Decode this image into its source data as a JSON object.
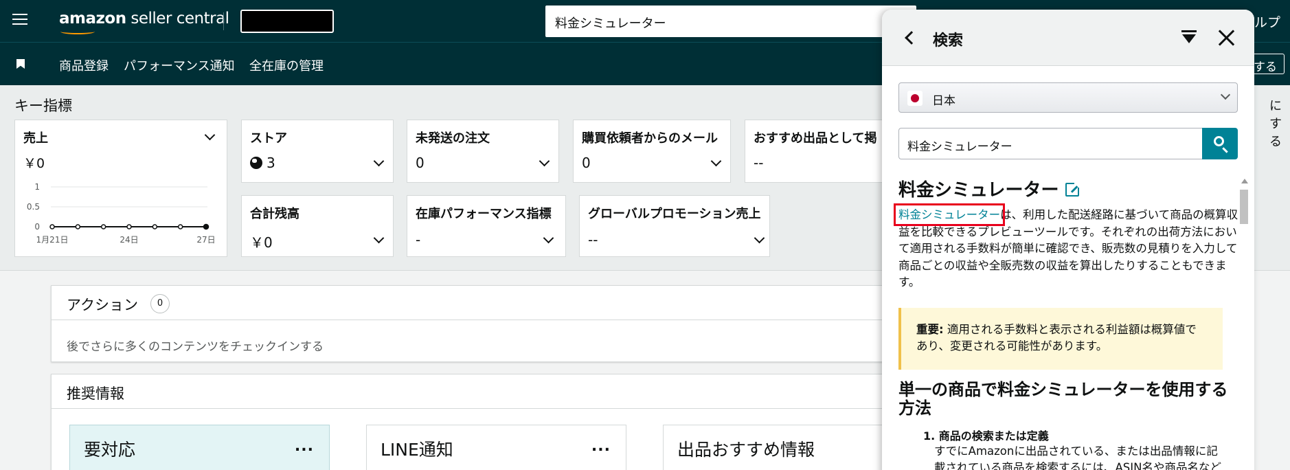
{
  "header": {
    "logo_main": "amazon",
    "logo_sub": " seller central",
    "search_value": "料金シミュレーター",
    "help_partial": "ルプ"
  },
  "nav": {
    "items": [
      "商品登録",
      "パフォーマンス通知",
      "全在庫の管理"
    ],
    "right_button_partial": "する"
  },
  "key_metrics": {
    "title": "キー指標",
    "right_partial": "にする",
    "sales": {
      "title": "売上",
      "value": "￥0",
      "y_ticks": [
        "1",
        "0.5",
        "0"
      ],
      "x_ticks": [
        "1月21日",
        "24日",
        "27日"
      ]
    },
    "cards": [
      {
        "title": "ストア",
        "value": "3"
      },
      {
        "title": "未発送の注文",
        "value": "0"
      },
      {
        "title": "購買依頼者からのメール",
        "value": "0"
      },
      {
        "title": "おすすめ出品として掲",
        "value": "--"
      },
      {
        "title": "合計残高",
        "value": "￥0"
      },
      {
        "title": "在庫パフォーマンス指標",
        "value": "-"
      },
      {
        "title": "グローバルプロモーション売上",
        "value": "--"
      }
    ]
  },
  "actions": {
    "title": "アクション",
    "count": "0",
    "empty_text": "後でさらに多くのコンテンツをチェックインする"
  },
  "recommendations": {
    "title": "推奨情報",
    "cards": [
      {
        "title": "要対応",
        "menu": "..."
      },
      {
        "title": "LINE通知",
        "menu": "..."
      },
      {
        "title": "出品おすすめ情報"
      }
    ]
  },
  "help_panel": {
    "title": "検索",
    "country": "日本",
    "search_value": "料金シミュレーター",
    "article_title": "料金シミュレーター",
    "link_text": "料金シミュレーター",
    "body_rest": "は、利用した配送経路に基づいて商品の概算収益を比較できるプレビューツールです。それぞれの出荷方法において適用される手数料が簡単に確認でき、販売数の見積りを入力して商品ごとの収益や全販売数の収益を算出したりすることもできます。",
    "note_label": "重要:",
    "note_text": " 適用される手数料と表示される利益額は概算値であり、変更される可能性があります。",
    "section_heading": "単一の商品で料金シミュレーターを使用する方法",
    "step_1_title": "1. 商品の検索または定義",
    "step_1_text": "すでにAmazonに出品されている、または出品情報に記載されている商品を検索するには、ASIN名や商品名などを入力して検索します。"
  },
  "chart_data": {
    "type": "line",
    "x": [
      "1月21日",
      "",
      "",
      "24日",
      "",
      "",
      "27日"
    ],
    "values": [
      0,
      0,
      0,
      0,
      0,
      0,
      0
    ],
    "ylim": [
      0,
      1
    ]
  },
  "colors": {
    "header_bg": "#002f36",
    "accent_teal": "#008296",
    "highlight_red": "#e8001c",
    "alert_card_bg": "#e3f4f5",
    "note_bg": "#fef8d9"
  }
}
